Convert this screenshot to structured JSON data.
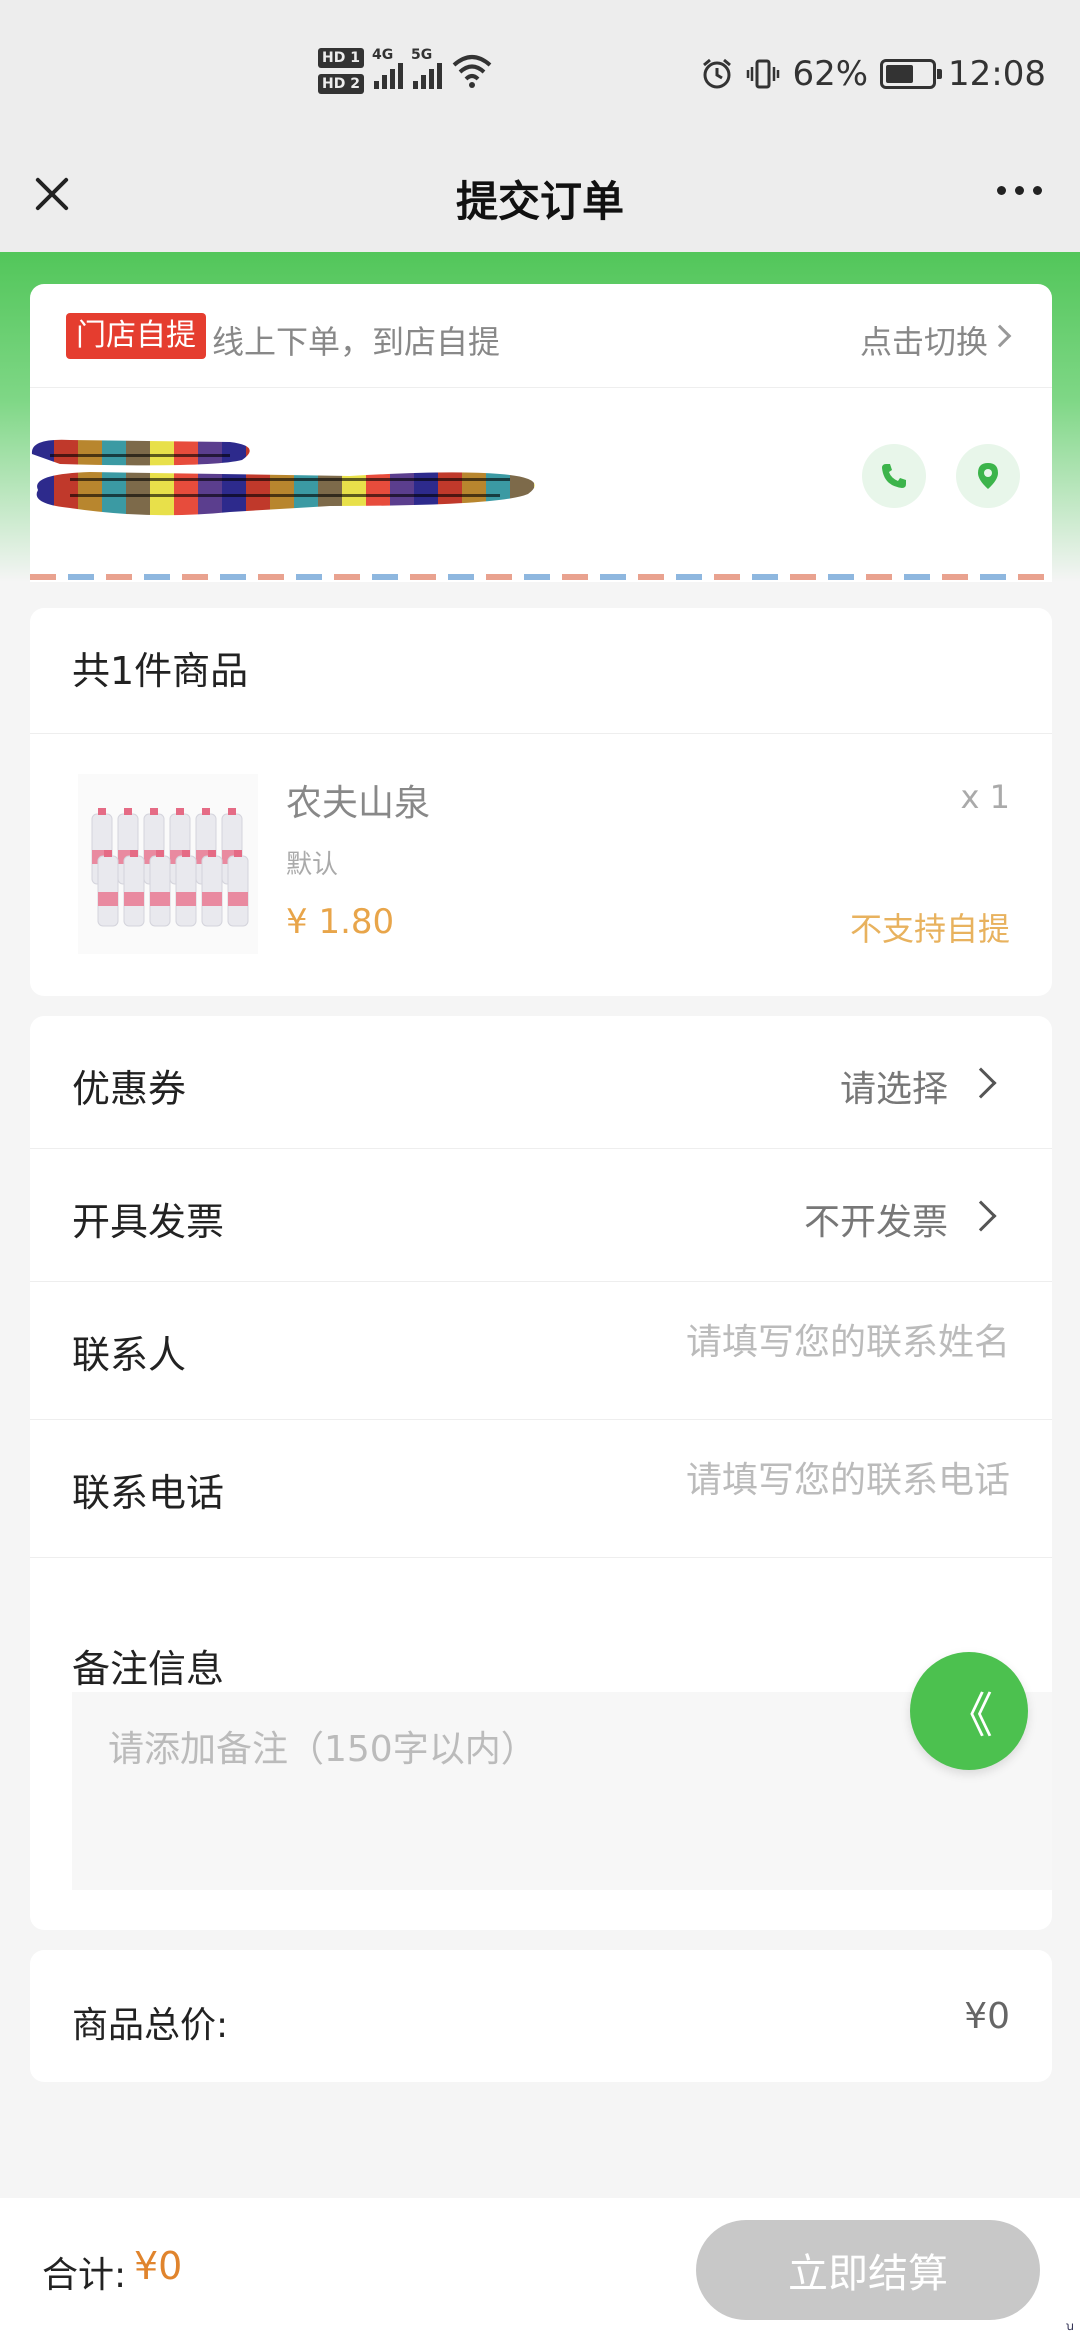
{
  "status_bar": {
    "hd1": "HD 1",
    "hd2": "HD 2",
    "net1": "4G",
    "net2": "5G",
    "battery_percent": "62%",
    "battery_level": 0.62,
    "time": "12:08",
    "icons": [
      "alarm-icon",
      "vibrate-icon",
      "wifi-icon",
      "battery-icon"
    ]
  },
  "navbar": {
    "title": "提交订单",
    "close_icon": "close-icon",
    "more_icon": "more-icon"
  },
  "pickup": {
    "tag": "门店自提",
    "description": "线上下单，到店自提",
    "switch_label": "点击切换"
  },
  "store": {
    "phone_icon": "phone-icon",
    "location_icon": "location-pin-icon"
  },
  "goods": {
    "header": "共1件商品",
    "items": [
      {
        "name": "农夫山泉",
        "spec": "默认",
        "price": "¥ 1.80",
        "quantity": "x 1",
        "note": "不支持自提"
      }
    ]
  },
  "form": {
    "coupon_label": "优惠券",
    "coupon_value": "请选择",
    "invoice_label": "开具发票",
    "invoice_value": "不开发票",
    "contact_label": "联系人",
    "contact_placeholder": "请填写您的联系姓名",
    "phone_label": "联系电话",
    "phone_placeholder": "请填写您的联系电话",
    "remark_label": "备注信息",
    "remark_placeholder": "请添加备注（150字以内）"
  },
  "total": {
    "label": "商品总价:",
    "value": "¥0"
  },
  "fab": {
    "glyph": "《"
  },
  "bottom": {
    "sum_label": "合计:",
    "sum_value": "¥0",
    "pay_button": "立即结算"
  },
  "colors": {
    "brand_green": "#52c65a",
    "pickup_tag_red": "#e53d2f",
    "price_orange": "#e8a54a",
    "pay_disabled": "#c8c8c8"
  }
}
